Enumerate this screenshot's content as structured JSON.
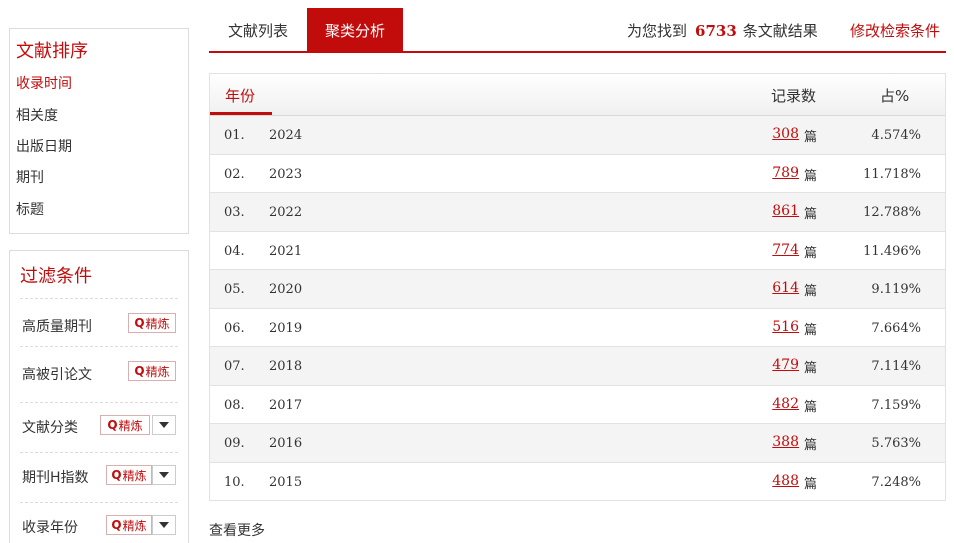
{
  "sort": {
    "title": "文献排序",
    "items": [
      {
        "label": "收录时间",
        "active": true
      },
      {
        "label": "相关度",
        "active": false
      },
      {
        "label": "出版日期",
        "active": false
      },
      {
        "label": "期刊",
        "active": false
      },
      {
        "label": "标题",
        "active": false
      }
    ]
  },
  "filter": {
    "title": "过滤条件",
    "refine_label": "精炼",
    "items": [
      {
        "label": "高质量期刊",
        "has_dropdown": false
      },
      {
        "label": "高被引论文",
        "has_dropdown": false
      },
      {
        "label": "文献分类",
        "has_dropdown": true
      },
      {
        "label": "期刊H指数",
        "has_dropdown": true
      },
      {
        "label": "收录年份",
        "has_dropdown": true
      }
    ]
  },
  "tabs": {
    "list_label": "文献列表",
    "cluster_label": "聚类分析"
  },
  "result": {
    "prefix": "为您找到",
    "count": "6733",
    "suffix": "条文献结果",
    "modify_label": "修改检索条件"
  },
  "table": {
    "col_year": "年份",
    "col_count": "记录数",
    "col_pct": "占%",
    "unit": "篇",
    "rows": [
      {
        "idx": "01.",
        "year": "2024",
        "count": "308",
        "pct": "4.574%"
      },
      {
        "idx": "02.",
        "year": "2023",
        "count": "789",
        "pct": "11.718%"
      },
      {
        "idx": "03.",
        "year": "2022",
        "count": "861",
        "pct": "12.788%"
      },
      {
        "idx": "04.",
        "year": "2021",
        "count": "774",
        "pct": "11.496%"
      },
      {
        "idx": "05.",
        "year": "2020",
        "count": "614",
        "pct": "9.119%"
      },
      {
        "idx": "06.",
        "year": "2019",
        "count": "516",
        "pct": "7.664%"
      },
      {
        "idx": "07.",
        "year": "2018",
        "count": "479",
        "pct": "7.114%"
      },
      {
        "idx": "08.",
        "year": "2017",
        "count": "482",
        "pct": "7.159%"
      },
      {
        "idx": "09.",
        "year": "2016",
        "count": "388",
        "pct": "5.763%"
      },
      {
        "idx": "10.",
        "year": "2015",
        "count": "488",
        "pct": "7.248%"
      }
    ]
  },
  "more_label": "查看更多",
  "colors": {
    "accent": "#c20c0c"
  },
  "icons": {
    "refine": "search-icon",
    "dropdown": "triangle-down-icon"
  }
}
